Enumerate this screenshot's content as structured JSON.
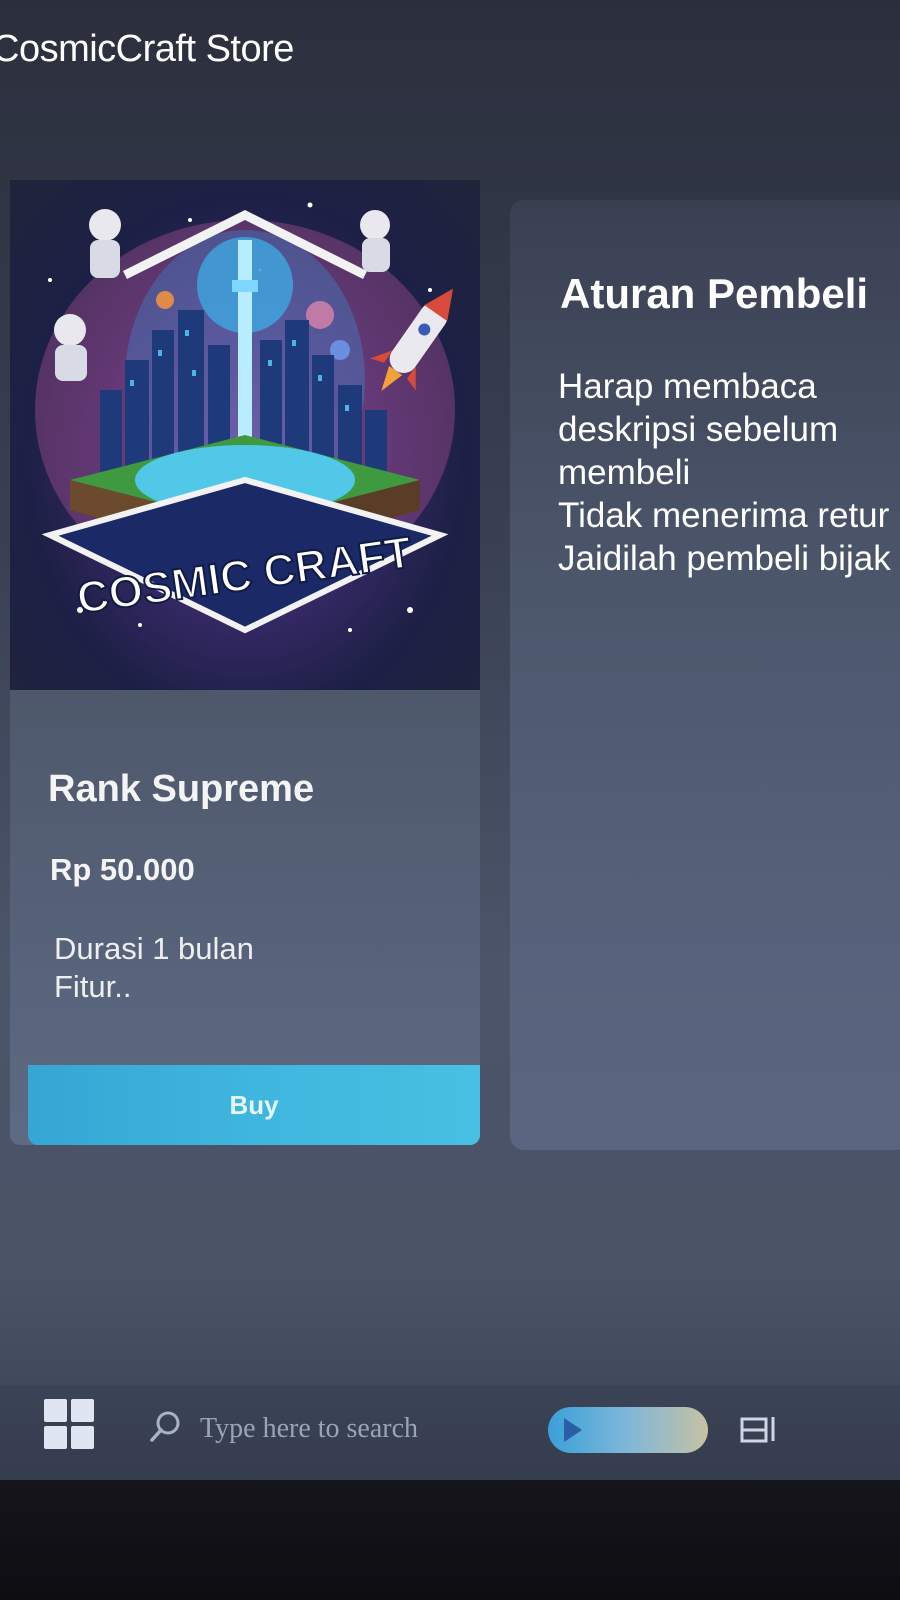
{
  "header": {
    "site_title": "CosmicCraft Store"
  },
  "product": {
    "image_logo_text": "COSMIC CRAFT",
    "name": "Rank Supreme",
    "price": "Rp 50.000",
    "description_lines": [
      "Durasi 1 bulan",
      "Fitur.."
    ],
    "buy_label": "Buy"
  },
  "rules": {
    "title": "Aturan Pembeli",
    "lines": [
      "Harap membaca",
      "deskripsi sebelum",
      "membeli",
      "Tidak menerima retur",
      "Jaidilah pembeli bijak"
    ]
  },
  "taskbar": {
    "start_icon": "windows-start-icon",
    "search_icon": "magnifier-icon",
    "search_placeholder": "Type here to search",
    "widget_icon": "media-widget-icon",
    "taskview_icon": "task-view-icon"
  },
  "colors": {
    "accent_button": "#3fb6de",
    "card_body": "#57637a",
    "page_bg": "#3a4154",
    "text": "#ffffff"
  }
}
